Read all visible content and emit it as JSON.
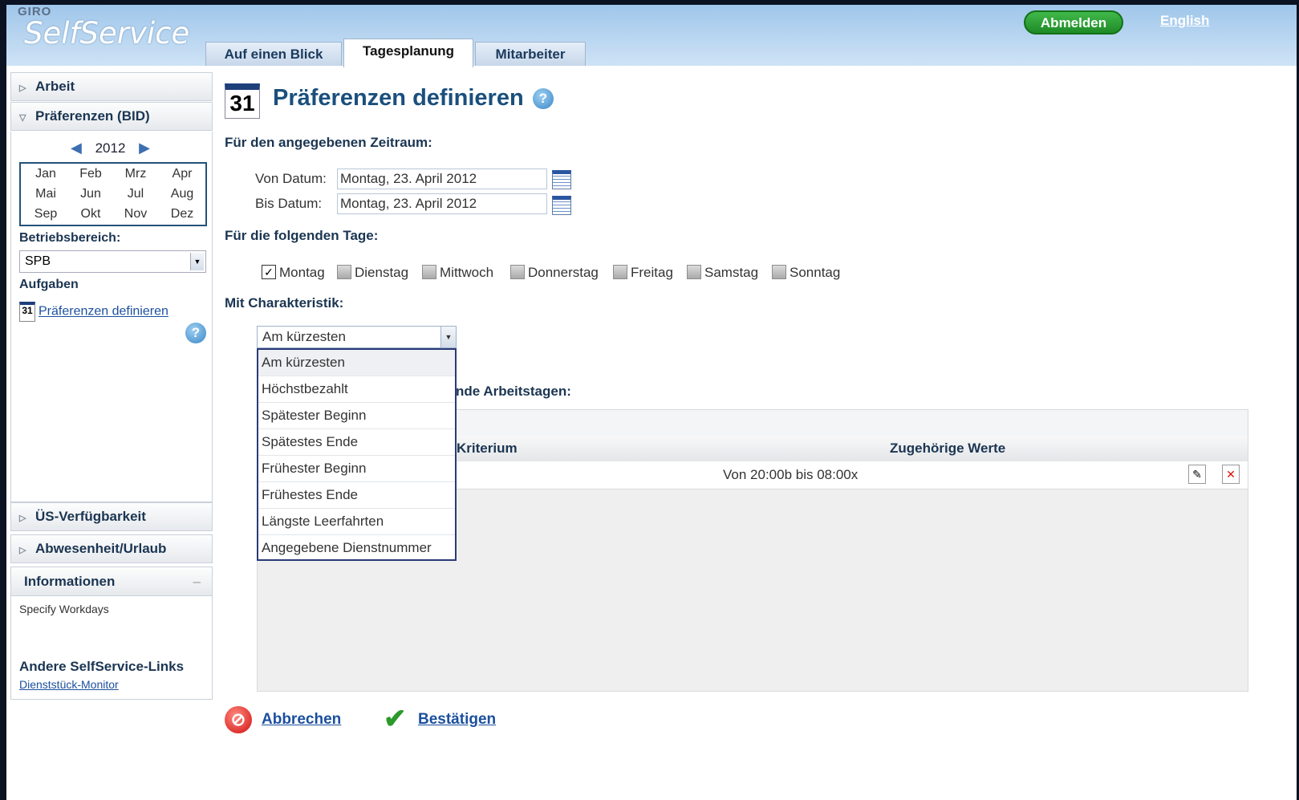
{
  "header": {
    "logo_small": "GIRO",
    "logo_main": "SelfService",
    "tabs": [
      {
        "label": "Auf einen Blick"
      },
      {
        "label": "Tagesplanung"
      },
      {
        "label": "Mitarbeiter"
      }
    ],
    "logout_label": "Abmelden",
    "language_link": "English"
  },
  "sidebar": {
    "acc_arbeit": "Arbeit",
    "acc_praeferenzen": "Präferenzen (BID)",
    "year": "2012",
    "months": [
      "Jan",
      "Feb",
      "Mrz",
      "Apr",
      "Mai",
      "Jun",
      "Jul",
      "Aug",
      "Sep",
      "Okt",
      "Nov",
      "Dez"
    ],
    "betriebsbereich_label": "Betriebsbereich:",
    "betriebsbereich_value": "SPB",
    "aufgaben_label": "Aufgaben",
    "task_link": "Präferenzen definieren",
    "task_icon_text": "31",
    "acc_us": "ÜS-Verfügbarkeit",
    "acc_abwesenheit": "Abwesenheit/Urlaub",
    "info_title": "Informationen",
    "info_text": "Specify Workdays",
    "links_title": "Andere SelfService-Links",
    "links_item": "Dienststück-Monitor"
  },
  "main": {
    "title": "Präferenzen definieren",
    "calendar_icon_text": "31",
    "section_period": "Für den angegebenen Zeitraum:",
    "von_label": "Von Datum:",
    "von_value": "Montag, 23. April 2012",
    "bis_label": "Bis Datum:",
    "bis_value": "Montag, 23. April 2012",
    "section_days": "Für die folgenden Tage:",
    "days": [
      {
        "label": "Montag",
        "checked": true
      },
      {
        "label": "Dienstag",
        "checked": false
      },
      {
        "label": "Mittwoch",
        "checked": false
      },
      {
        "label": "Donnerstag",
        "checked": false
      },
      {
        "label": "Freitag",
        "checked": false
      },
      {
        "label": "Samstag",
        "checked": false
      },
      {
        "label": "Sonntag",
        "checked": false
      }
    ],
    "section_char": "Mit Charakteristik:",
    "char_value": "Am kürzesten",
    "char_options": [
      "Am kürzesten",
      "Höchstbezahlt",
      "Spätester Beginn",
      "Spätestes Ende",
      "Frühester Beginn",
      "Frühestes Ende",
      "Längste Leerfahrten",
      "Angegebene Dienstnummer"
    ],
    "section_workdays_partial": "nde Arbeitstagen:",
    "grid_col_criterion": "Kriterium",
    "grid_col_values": "Zugehörige Werte",
    "grid_row_value": "Von 20:00b bis 08:00x",
    "cancel_label": "Abbrechen",
    "confirm_label": "Bestätigen"
  },
  "colors": {
    "header_bg": "#9fc6ea",
    "title_blue": "#1a4f7d",
    "link_blue": "#1b4f9e",
    "logout_green": "#2ea336"
  }
}
